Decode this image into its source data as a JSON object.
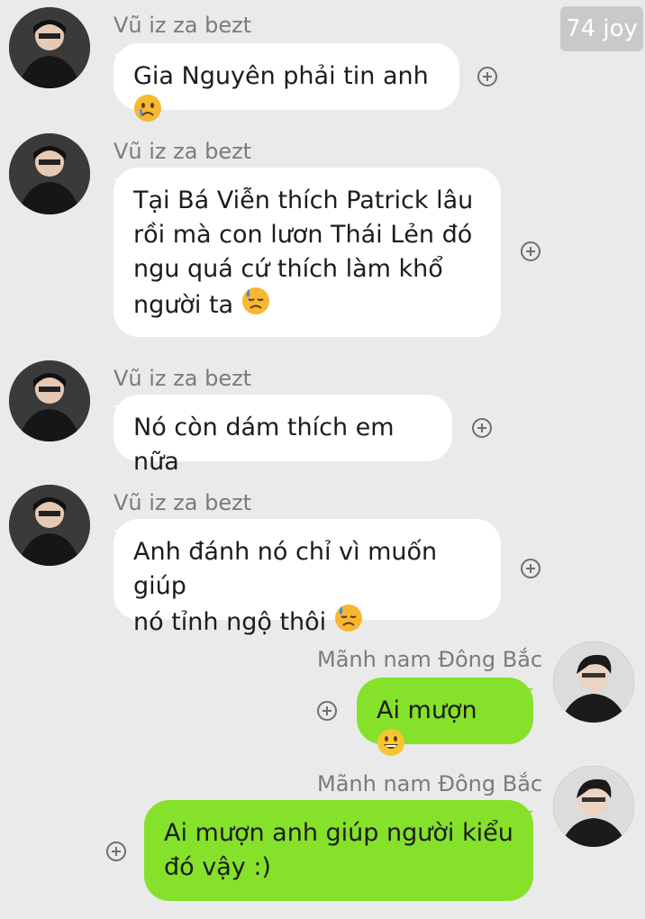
{
  "watermark": {
    "text": "74 joy"
  },
  "messages": [
    {
      "sender": "Vũ iz za bezt",
      "text": "Gia Nguyên phải tin anh",
      "emoji": "crying-face"
    },
    {
      "sender": "Vũ iz za bezt",
      "lines": [
        "Tại Bá Viễn thích Patrick lâu",
        "rồi mà con lươn Thái Lẻn đó",
        "ngu quá cứ thích làm khổ",
        "người ta"
      ],
      "emoji": "downcast-sweat-face"
    },
    {
      "sender": "Vũ iz za bezt",
      "text": "Nó còn dám thích em nữa"
    },
    {
      "sender": "Vũ iz za bezt",
      "lines": [
        "Anh đánh nó chỉ vì muốn giúp",
        "nó tỉnh ngộ thôi"
      ],
      "emoji": "downcast-sweat-face"
    },
    {
      "sender": "Mãnh nam Đông Bắc",
      "text": "Ai mượn",
      "emoji": "grinning-face"
    },
    {
      "sender": "Mãnh nam Đông Bắc",
      "lines": [
        "Ai mượn anh giúp người kiểu",
        "đó vậy :)"
      ]
    }
  ],
  "colors": {
    "incoming_bubble": "#ffffff",
    "outgoing_bubble": "#85e12a",
    "background": "#eaeaea"
  }
}
